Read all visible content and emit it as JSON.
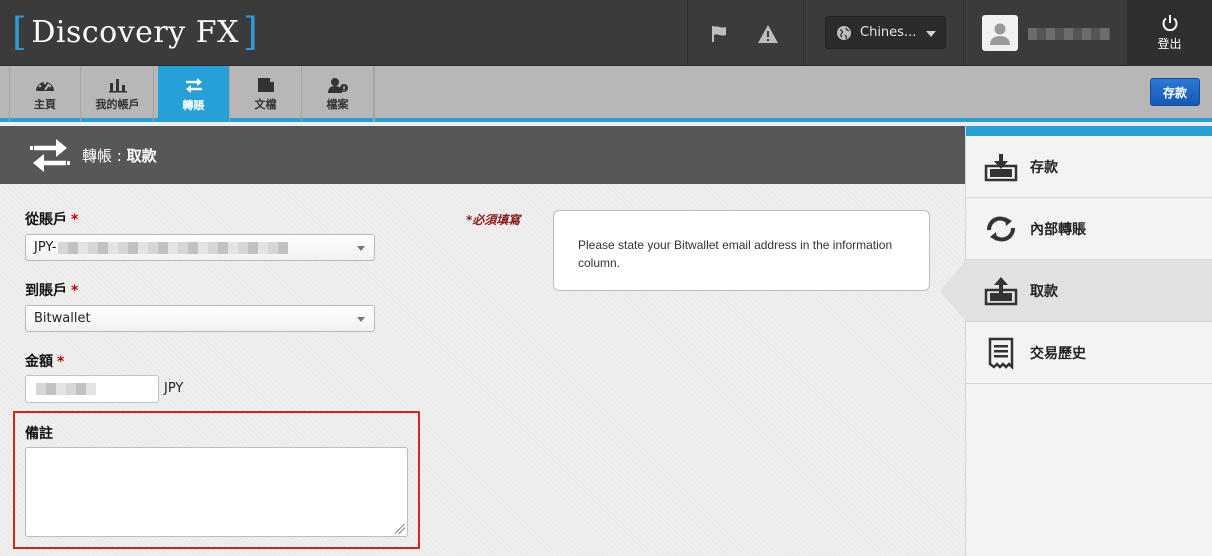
{
  "header": {
    "logo_text": "Discovery FX",
    "language": "Chines...",
    "logout_label": "登出",
    "icons": [
      "flag-icon",
      "warning-icon",
      "globe-icon",
      "user-icon",
      "power-icon"
    ]
  },
  "nav": {
    "tabs": [
      {
        "label": "主頁",
        "icon": "dashboard-icon"
      },
      {
        "label": "我的帳戶",
        "icon": "chart-icon"
      },
      {
        "label": "轉賬",
        "icon": "transfer-icon"
      },
      {
        "label": "文檔",
        "icon": "document-icon"
      },
      {
        "label": "檔案",
        "icon": "profile-icon"
      }
    ],
    "active_tab": "轉賬",
    "deposit_button": "存款"
  },
  "page": {
    "title_prefix": "轉帳 : ",
    "title_sub": "取款"
  },
  "form": {
    "from_account_label": "從賬戶",
    "from_account_value": "JPY-",
    "to_account_label": "到賬戶",
    "to_account_value": "Bitwallet",
    "amount_label": "金額",
    "amount_currency": "JPY",
    "memo_label": "備註",
    "required_marker": "*",
    "required_note": "*必須填寫"
  },
  "info": {
    "text": "Please state your Bitwallet email address in the information column."
  },
  "sidebar": {
    "items": [
      {
        "label": "存款",
        "icon": "deposit-icon"
      },
      {
        "label": "內部轉賬",
        "icon": "internal-transfer-icon"
      },
      {
        "label": "取款",
        "icon": "withdraw-icon"
      },
      {
        "label": "交易歷史",
        "icon": "history-icon"
      }
    ],
    "active_item": "取款"
  },
  "colors": {
    "accent": "#27a0d8",
    "header_bg": "#3b3b3b",
    "required": "#c00000",
    "highlight_border": "#d9251c",
    "button_blue": "#1559b5"
  }
}
